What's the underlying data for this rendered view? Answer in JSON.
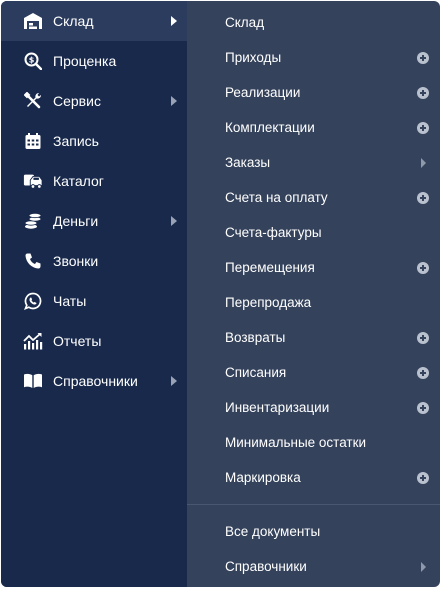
{
  "sidebar": {
    "items": [
      {
        "label": "Склад",
        "icon": "warehouse-icon",
        "active": true,
        "arrow": true
      },
      {
        "label": "Проценка",
        "icon": "price-search-icon",
        "active": false,
        "arrow": false
      },
      {
        "label": "Сервис",
        "icon": "tools-icon",
        "active": false,
        "arrow": true
      },
      {
        "label": "Запись",
        "icon": "calendar-icon",
        "active": false,
        "arrow": false
      },
      {
        "label": "Каталог",
        "icon": "car-catalog-icon",
        "active": false,
        "arrow": false
      },
      {
        "label": "Деньги",
        "icon": "coins-icon",
        "active": false,
        "arrow": true
      },
      {
        "label": "Звонки",
        "icon": "phone-icon",
        "active": false,
        "arrow": false
      },
      {
        "label": "Чаты",
        "icon": "whatsapp-icon",
        "active": false,
        "arrow": false
      },
      {
        "label": "Отчеты",
        "icon": "chart-icon",
        "active": false,
        "arrow": false
      },
      {
        "label": "Справочники",
        "icon": "book-icon",
        "active": false,
        "arrow": true
      }
    ]
  },
  "submenu": {
    "items": [
      {
        "label": "Склад",
        "action": "none"
      },
      {
        "label": "Приходы",
        "action": "plus"
      },
      {
        "label": "Реализации",
        "action": "plus"
      },
      {
        "label": "Комплектации",
        "action": "plus"
      },
      {
        "label": "Заказы",
        "action": "arrow"
      },
      {
        "label": "Счета на оплату",
        "action": "plus"
      },
      {
        "label": "Счета-фактуры",
        "action": "none"
      },
      {
        "label": "Перемещения",
        "action": "plus"
      },
      {
        "label": "Перепродажа",
        "action": "none"
      },
      {
        "label": "Возвраты",
        "action": "plus"
      },
      {
        "label": "Списания",
        "action": "plus"
      },
      {
        "label": "Инвентаризации",
        "action": "plus"
      },
      {
        "label": "Минимальные остатки",
        "action": "none"
      },
      {
        "label": "Маркировка",
        "action": "plus"
      }
    ],
    "footer_items": [
      {
        "label": "Все документы",
        "action": "none"
      },
      {
        "label": "Справочники",
        "action": "arrow"
      }
    ]
  },
  "colors": {
    "sidebar_bg": "#18294b",
    "sidebar_active_bg": "#2c3c5e",
    "submenu_bg": "#34425b",
    "text": "#ffffff",
    "plus_icon": "#b9c1cf"
  }
}
